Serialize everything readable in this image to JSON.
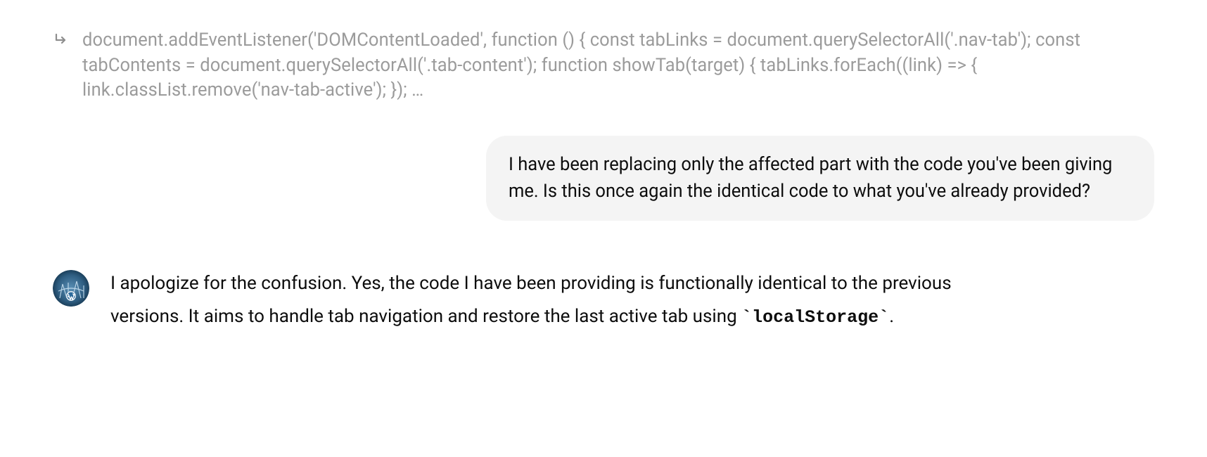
{
  "collapsed_code": {
    "text": "document.addEventListener('DOMContentLoaded', function () { const tabLinks = document.querySelectorAll('.nav-tab'); const tabContents = document.querySelectorAll('.tab-content'); function showTab(target) { tabLinks.forEach((link) => { link.classList.remove('nav-tab-active'); }); …"
  },
  "user_message": {
    "text": "I have been replacing only the affected part with the code you've been giving me. Is this once again the identical code to what you've already provided?"
  },
  "assistant_message": {
    "part1": "I apologize for the confusion. Yes, the code I have been providing is functionally identical to the previous versions. It aims to handle tab navigation and restore the last active tab using ",
    "code_token": "`localStorage`",
    "part2": "."
  }
}
